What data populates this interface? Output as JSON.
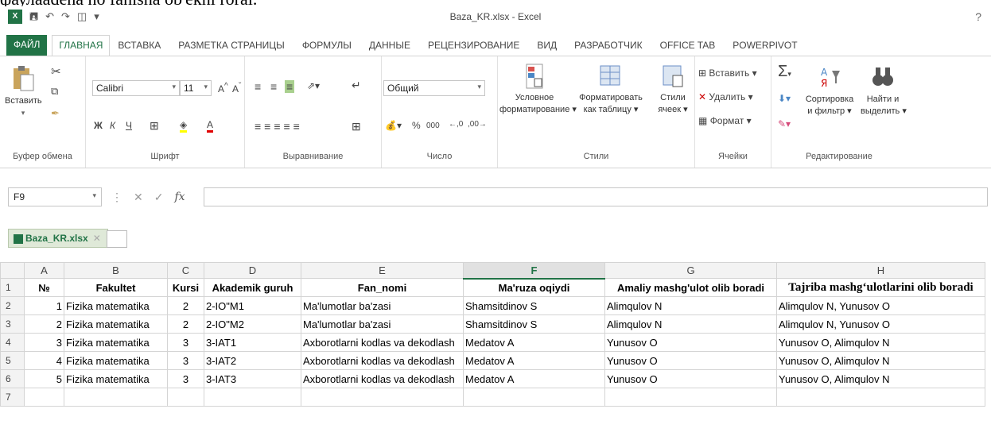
{
  "page_top_text": "фаулаadena no fanisha ob'ekni rorai.",
  "window": {
    "title": "Baza_KR.xlsx - Excel",
    "help": "?"
  },
  "tabs": [
    "ФАЙЛ",
    "ГЛАВНАЯ",
    "ВСТАВКА",
    "РАЗМЕТКА СТРАНИЦЫ",
    "ФОРМУЛЫ",
    "ДАННЫЕ",
    "РЕЦЕНЗИРОВАНИЕ",
    "ВИД",
    "РАЗРАБОТЧИК",
    "OFFICE TAB",
    "POWERPIVOT"
  ],
  "active_tab": "ГЛАВНАЯ",
  "ribbon": {
    "clipboard": {
      "paste": "Вставить",
      "label": "Буфер обмена"
    },
    "font": {
      "name": "Calibri",
      "size": "11",
      "bold": "Ж",
      "italic": "К",
      "underline": "Ч",
      "label": "Шрифт"
    },
    "alignment": {
      "label": "Выравнивание"
    },
    "number": {
      "format": "Общий",
      "percent": "%",
      "thousands": "000",
      "label": "Число"
    },
    "styles": {
      "conditional": "Условное",
      "conditional2": "форматирование",
      "table": "Форматировать",
      "table2": "как таблицу",
      "cell": "Стили",
      "cell2": "ячеек",
      "label": "Стили"
    },
    "cells": {
      "insert": "Вставить",
      "delete": "Удалить",
      "format": "Формат",
      "label": "Ячейки"
    },
    "editing": {
      "sort": "Сортировка",
      "sort2": "и фильтр",
      "find": "Найти и",
      "find2": "выделить",
      "label": "Редактирование"
    }
  },
  "formula_bar": {
    "name_box": "F9",
    "fx": "fx",
    "value": ""
  },
  "office_tab": {
    "file": "Baza_KR.xlsx"
  },
  "colors": {
    "excel_green": "#217346"
  },
  "sheet": {
    "columns": [
      "A",
      "B",
      "C",
      "D",
      "E",
      "F",
      "G",
      "H"
    ],
    "selected_column": "F",
    "header": [
      "№",
      "Fakultet",
      "Kursi",
      "Akademik guruh",
      "Fan_nomi",
      "Ma'ruza oqiydi",
      "Amaliy mashg'ulot olib boradi",
      "Tajriba mashg‘ulotlarini olib boradi"
    ],
    "rows": [
      [
        "1",
        "Fizika matematika",
        "2",
        "2-IO\"M1",
        "Ma'lumotlar ba'zasi",
        "Shamsitdinov S",
        "Alimqulov N",
        "Alimqulov N, Yunusov O"
      ],
      [
        "2",
        "Fizika matematika",
        "2",
        "2-IO\"M2",
        "Ma'lumotlar ba'zasi",
        "Shamsitdinov S",
        "Alimqulov N",
        "Alimqulov N, Yunusov O"
      ],
      [
        "3",
        "Fizika matematika",
        "3",
        "3-IAT1",
        "Axborotlarni kodlas va dekodlash",
        "Medatov A",
        "Yunusov O",
        "Yunusov O, Alimqulov N"
      ],
      [
        "4",
        "Fizika matematika",
        "3",
        "3-IAT2",
        "Axborotlarni kodlas va dekodlash",
        "Medatov A",
        "Yunusov O",
        "Yunusov O, Alimqulov N"
      ],
      [
        "5",
        "Fizika matematika",
        "3",
        "3-IAT3",
        "Axborotlarni kodlas va dekodlash",
        "Medatov A",
        "Yunusov O",
        "Yunusov O, Alimqulov N"
      ]
    ],
    "row_numbers": [
      "1",
      "2",
      "3",
      "4",
      "5",
      "6",
      "7"
    ]
  }
}
